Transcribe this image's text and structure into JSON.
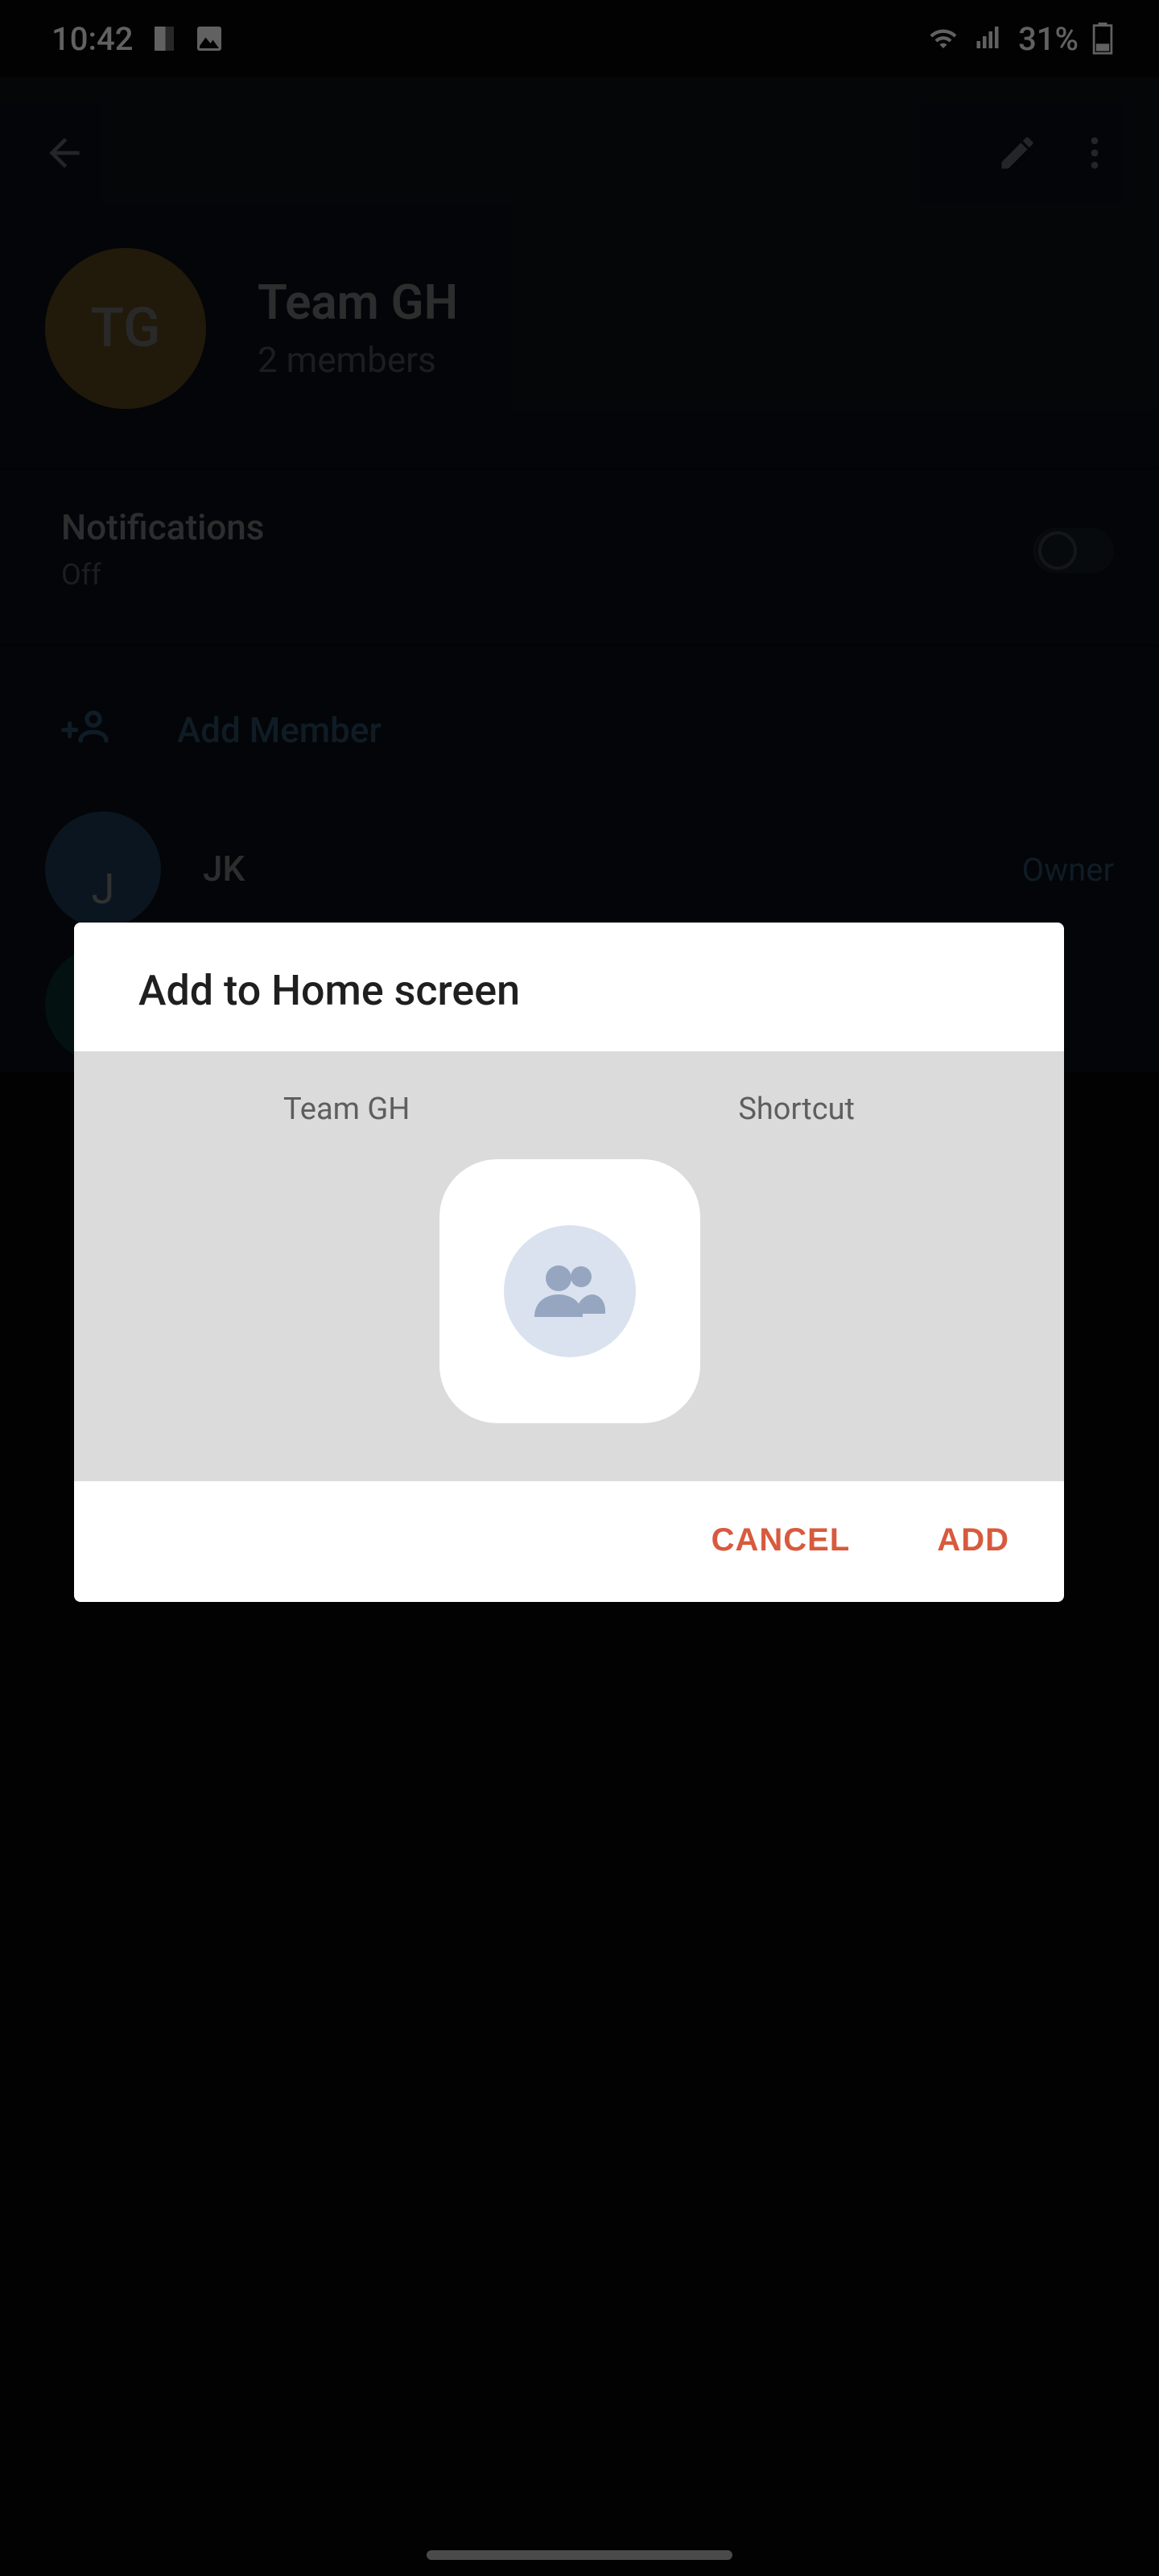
{
  "status": {
    "time": "10:42",
    "battery": "31%"
  },
  "appbar": {},
  "group": {
    "avatar_initials": "TG",
    "name": "Team GH",
    "member_count": "2 members"
  },
  "notifications": {
    "title": "Notifications",
    "value": "Off"
  },
  "members": {
    "add_label": "Add Member",
    "list": [
      {
        "initials": "J",
        "name": "JK",
        "role": "Owner"
      }
    ]
  },
  "dialog": {
    "title": "Add to Home screen",
    "preview_name": "Team GH",
    "preview_shortcut": "Shortcut",
    "cancel": "CANCEL",
    "add": "ADD"
  }
}
